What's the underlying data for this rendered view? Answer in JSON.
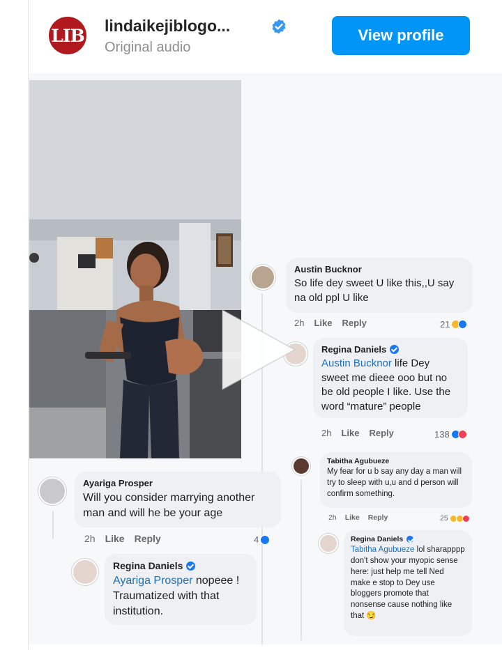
{
  "header": {
    "account_name": "lindaikejiblogo...",
    "subtitle": "Original audio",
    "avatar_text": "LIB",
    "view_profile_label": "View profile"
  },
  "comments": [
    {
      "author": "Austin Bucknor",
      "text": "So life dey sweet U like this,,U say na old ppl U like",
      "time": "2h",
      "like": "Like",
      "reply": "Reply",
      "count": "21"
    },
    {
      "author": "Regina Daniels",
      "mention": "Austin Bucknor",
      "text": " life Dey sweet me dieee ooo but no be old people I like. Use the word “mature” people",
      "time": "2h",
      "like": "Like",
      "reply": "Reply",
      "count": "138"
    },
    {
      "author": "Tabitha Agubueze",
      "text": "My fear for u b say any day a man will try to sleep with u,u and d person will confirm something.",
      "time": "2h",
      "like": "Like",
      "reply": "Reply",
      "count": "25"
    },
    {
      "author": "Regina Daniels",
      "mention": "Tabitha Agubueze",
      "text": " lol sharapppp don't show your myopic sense here: just help me tell Ned make e stop to Dey use bloggers promote that nonsense cause nothing like that 😏"
    },
    {
      "author": "Ayariga Prosper",
      "text": "Will you consider marrying another man and will he be your age",
      "time": "2h",
      "like": "Like",
      "reply": "Reply",
      "count": "4"
    },
    {
      "author": "Regina Daniels",
      "mention": "Ayariga Prosper",
      "text": " nopeee ! Traumatized with that institution."
    }
  ],
  "colors": {
    "accent": "#0095f6",
    "brand": "#b01a1f",
    "mention": "#1f6fb5",
    "verified": "#1877f2"
  }
}
